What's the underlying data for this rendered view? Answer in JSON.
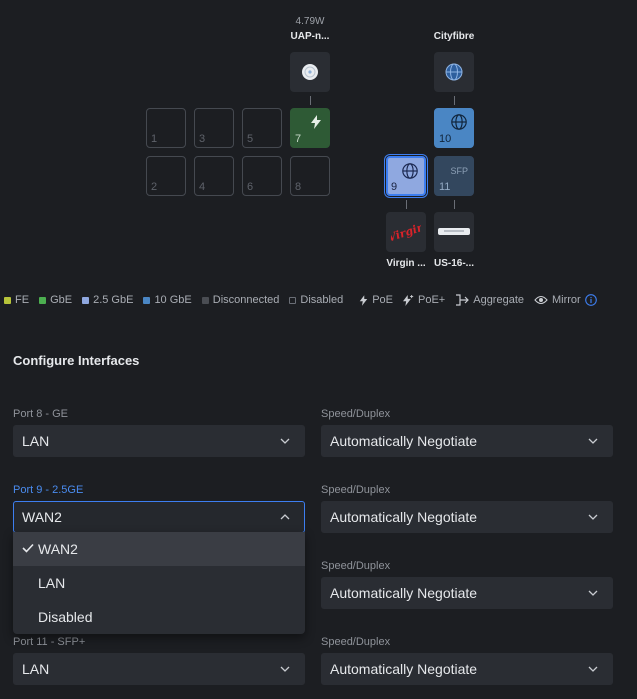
{
  "diagram": {
    "uap": {
      "power": "4.79W",
      "name": "UAP-n..."
    },
    "cityfibre": {
      "name": "Cityfibre"
    },
    "virgin": {
      "name": "Virgin ...",
      "logo_text": "Virgin"
    },
    "us16": {
      "name": "US-16-..."
    },
    "ports": [
      {
        "num": "1"
      },
      {
        "num": "2"
      },
      {
        "num": "3"
      },
      {
        "num": "4"
      },
      {
        "num": "5"
      },
      {
        "num": "6"
      },
      {
        "num": "7"
      },
      {
        "num": "8"
      },
      {
        "num": "9"
      },
      {
        "num": "10"
      },
      {
        "num": "11",
        "label": "SFP"
      }
    ]
  },
  "legend": {
    "fe": "FE",
    "gbe": "GbE",
    "g25": "2.5 GbE",
    "g10": "10 GbE",
    "disconnected": "Disconnected",
    "disabled": "Disabled",
    "poe": "PoE",
    "poeplus": "PoE+",
    "aggregate": "Aggregate",
    "mirror": "Mirror",
    "colors": {
      "fe": "#b7c43a",
      "gbe": "#4caf50",
      "g25": "#8fa8e0",
      "g10": "#4a86c4",
      "disconnected": "#4a4d53"
    }
  },
  "config": {
    "title": "Configure Interfaces",
    "rows": [
      {
        "port_label": "Port 8 - GE",
        "port_value": "LAN",
        "speed_label": "Speed/Duplex",
        "speed_value": "Automatically Negotiate"
      },
      {
        "port_label": "Port 9 - 2.5GE",
        "port_value": "WAN2",
        "speed_label": "Speed/Duplex",
        "speed_value": "Automatically Negotiate"
      },
      {
        "speed_label": "Speed/Duplex",
        "speed_value": "Automatically Negotiate"
      },
      {
        "port_label": "Port 11 - SFP+",
        "port_value": "LAN",
        "speed_label": "Speed/Duplex",
        "speed_value": "Automatically Negotiate"
      }
    ],
    "dropdown": {
      "options": [
        "WAN2",
        "LAN",
        "Disabled"
      ],
      "selected": "WAN2"
    }
  }
}
